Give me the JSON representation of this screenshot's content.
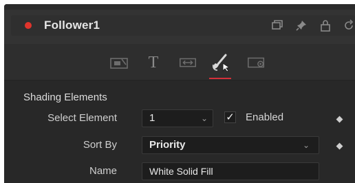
{
  "node": {
    "title": "Follower1",
    "status_color": "#e0342c",
    "header_icons": [
      "restore-window-icon",
      "pin-icon",
      "lock-icon",
      "reset-icon"
    ]
  },
  "tabs": {
    "items": [
      {
        "icon": "controls-tab-icon"
      },
      {
        "icon": "text-tab-icon",
        "glyph": "T"
      },
      {
        "icon": "layout-tab-icon"
      },
      {
        "icon": "shading-brush-icon",
        "active": true
      },
      {
        "icon": "image-settings-tab-icon"
      }
    ],
    "active_color": "#d5303a"
  },
  "shading": {
    "section_title": "Shading Elements",
    "select_element_label": "Select Element",
    "select_element_value": "1",
    "enabled_label": "Enabled",
    "enabled_checked": true,
    "check_glyph": "✓",
    "sort_by_label": "Sort By",
    "sort_by_value": "Priority",
    "name_label": "Name",
    "name_value": "White Solid Fill",
    "chevron_glyph": "⌄"
  }
}
